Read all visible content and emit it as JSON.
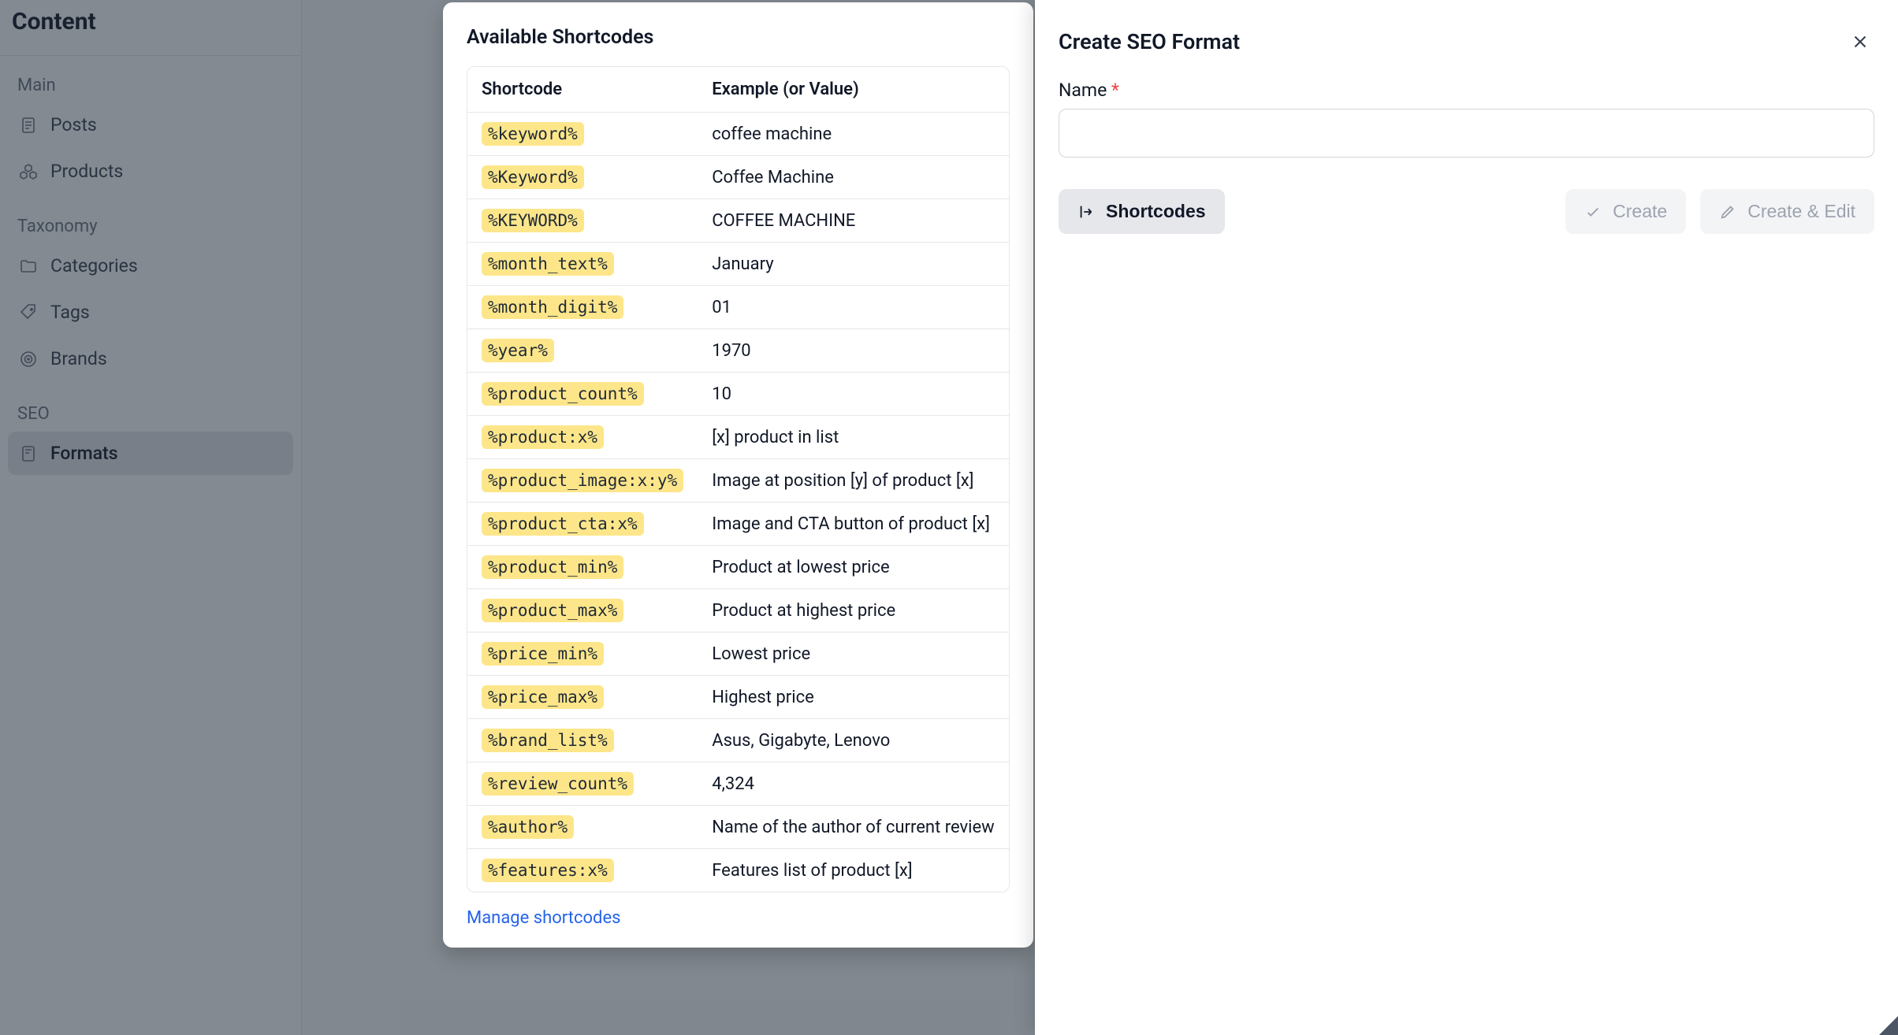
{
  "sidebar": {
    "title": "Content",
    "sections": [
      {
        "label": "Main",
        "items": [
          {
            "name": "posts",
            "label": "Posts"
          },
          {
            "name": "products",
            "label": "Products"
          }
        ]
      },
      {
        "label": "Taxonomy",
        "items": [
          {
            "name": "categories",
            "label": "Categories"
          },
          {
            "name": "tags",
            "label": "Tags"
          },
          {
            "name": "brands",
            "label": "Brands"
          }
        ]
      },
      {
        "label": "SEO",
        "items": [
          {
            "name": "formats",
            "label": "Formats"
          }
        ]
      }
    ]
  },
  "modal": {
    "title": "Available Shortcodes",
    "col1": "Shortcode",
    "col2": "Example (or Value)",
    "rows": [
      {
        "code": "%keyword%",
        "example": "coffee machine"
      },
      {
        "code": "%Keyword%",
        "example": "Coffee Machine"
      },
      {
        "code": "%KEYWORD%",
        "example": "COFFEE MACHINE"
      },
      {
        "code": "%month_text%",
        "example": "January"
      },
      {
        "code": "%month_digit%",
        "example": "01"
      },
      {
        "code": "%year%",
        "example": "1970"
      },
      {
        "code": "%product_count%",
        "example": "10"
      },
      {
        "code": "%product:x%",
        "example": "[x] product in list"
      },
      {
        "code": "%product_image:x:y%",
        "example": "Image at position [y] of product [x]"
      },
      {
        "code": "%product_cta:x%",
        "example": "Image and CTA button of product [x]"
      },
      {
        "code": "%product_min%",
        "example": "Product at lowest price"
      },
      {
        "code": "%product_max%",
        "example": "Product at highest price"
      },
      {
        "code": "%price_min%",
        "example": "Lowest price"
      },
      {
        "code": "%price_max%",
        "example": "Highest price"
      },
      {
        "code": "%brand_list%",
        "example": "Asus, Gigabyte, Lenovo"
      },
      {
        "code": "%review_count%",
        "example": "4,324"
      },
      {
        "code": "%author%",
        "example": "Name of the author of current review"
      },
      {
        "code": "%features:x%",
        "example": "Features list of product [x]"
      }
    ],
    "manage_link": "Manage shortcodes"
  },
  "drawer": {
    "title": "Create SEO Format",
    "name_label": "Name",
    "required": "*",
    "name_value": "",
    "buttons": {
      "shortcodes": "Shortcodes",
      "create": "Create",
      "create_edit": "Create & Edit"
    }
  }
}
